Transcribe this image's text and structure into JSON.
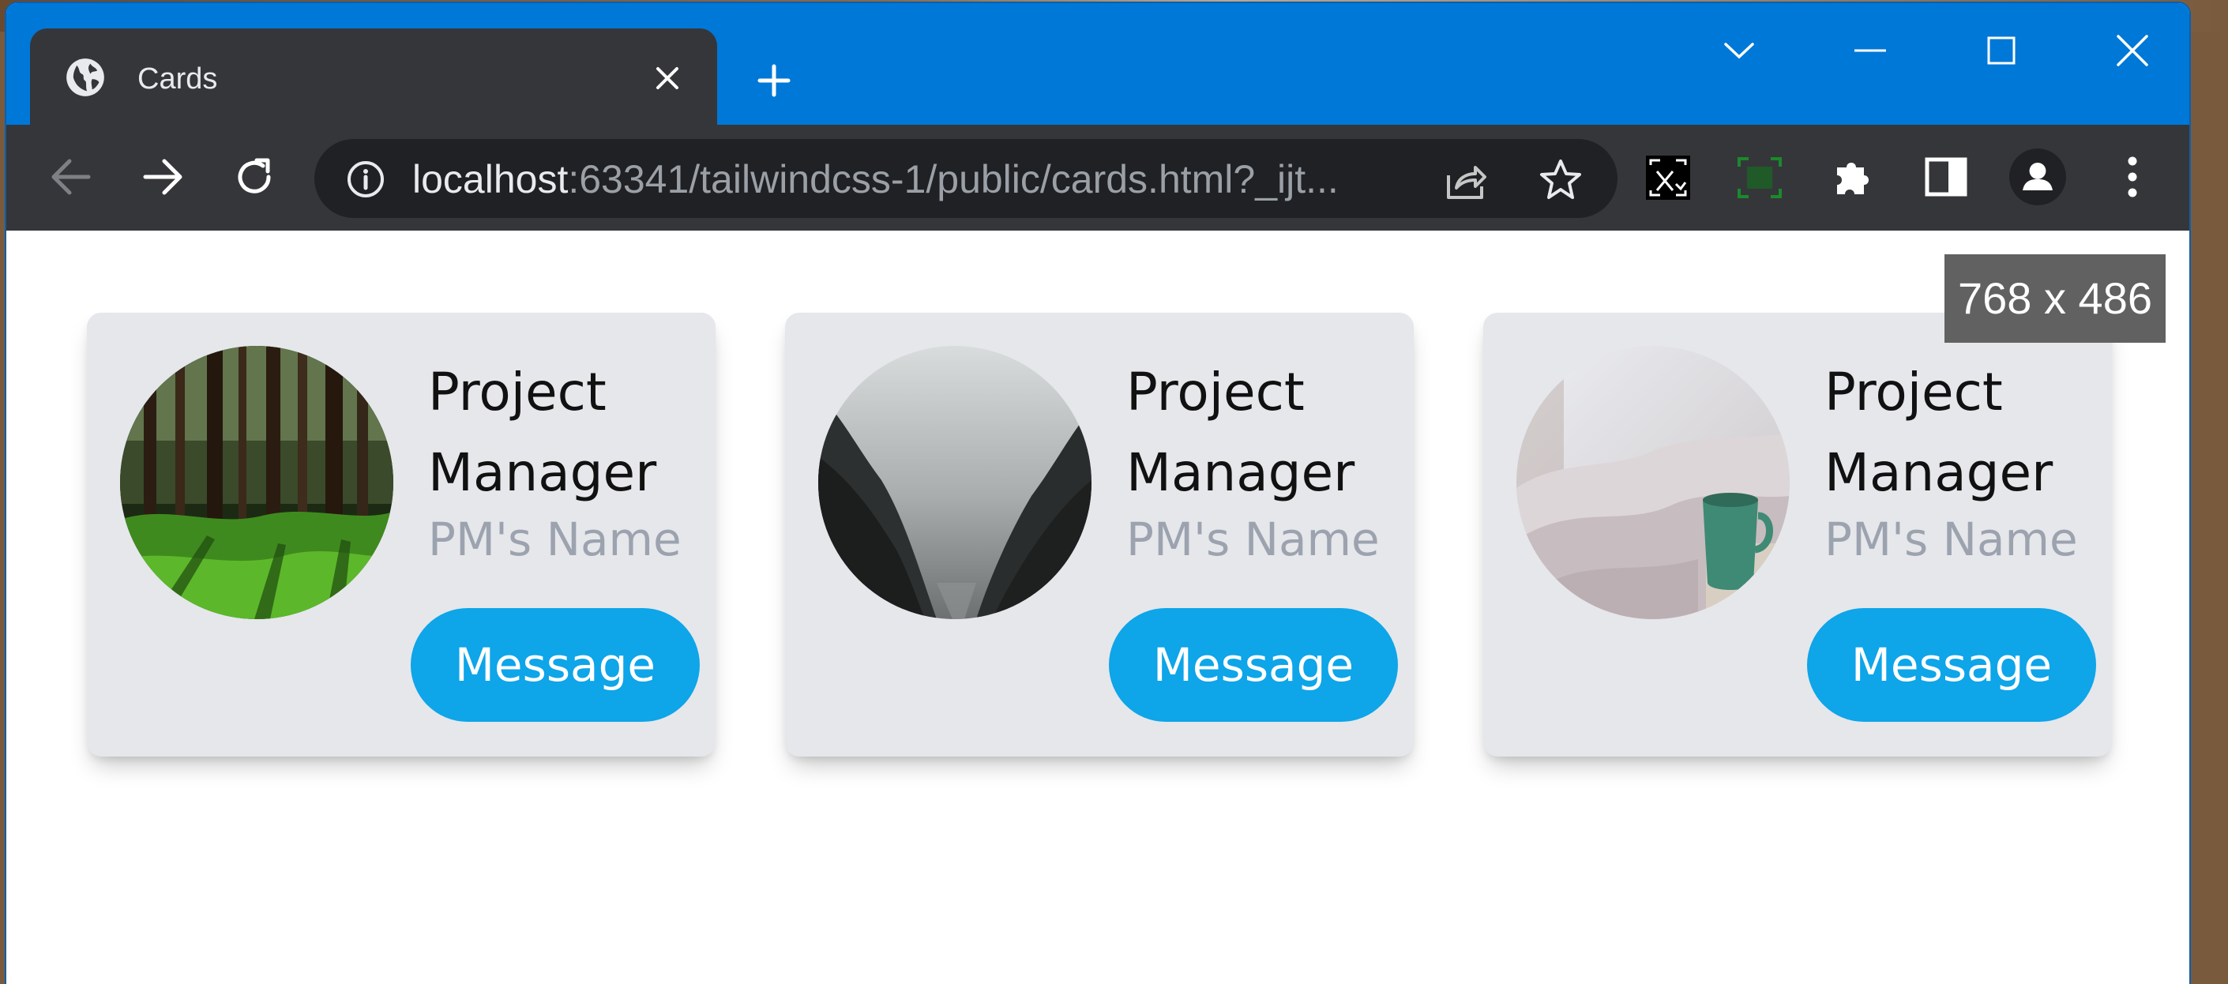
{
  "tab": {
    "title": "Cards",
    "icon": "globe-icon"
  },
  "address_bar": {
    "host": "localhost",
    "rest": ":63341/tailwindcss-1/public/cards.html?_ijt..."
  },
  "viewport_size_badge": "768 x 486",
  "cards": [
    {
      "title": "Project Manager",
      "name": "PM's Name",
      "button_label": "Message",
      "image": "forest"
    },
    {
      "title": "Project Manager",
      "name": "PM's Name",
      "button_label": "Message",
      "image": "misty-canyon"
    },
    {
      "title": "Project Manager",
      "name": "PM's Name",
      "button_label": "Message",
      "image": "bed-with-mug"
    }
  ],
  "colors": {
    "titlebar": "#0078d7",
    "toolbar": "#35363a",
    "card_bg": "#e5e7eb",
    "button": "#0ea5e9",
    "name_text": "#9ca3af"
  }
}
